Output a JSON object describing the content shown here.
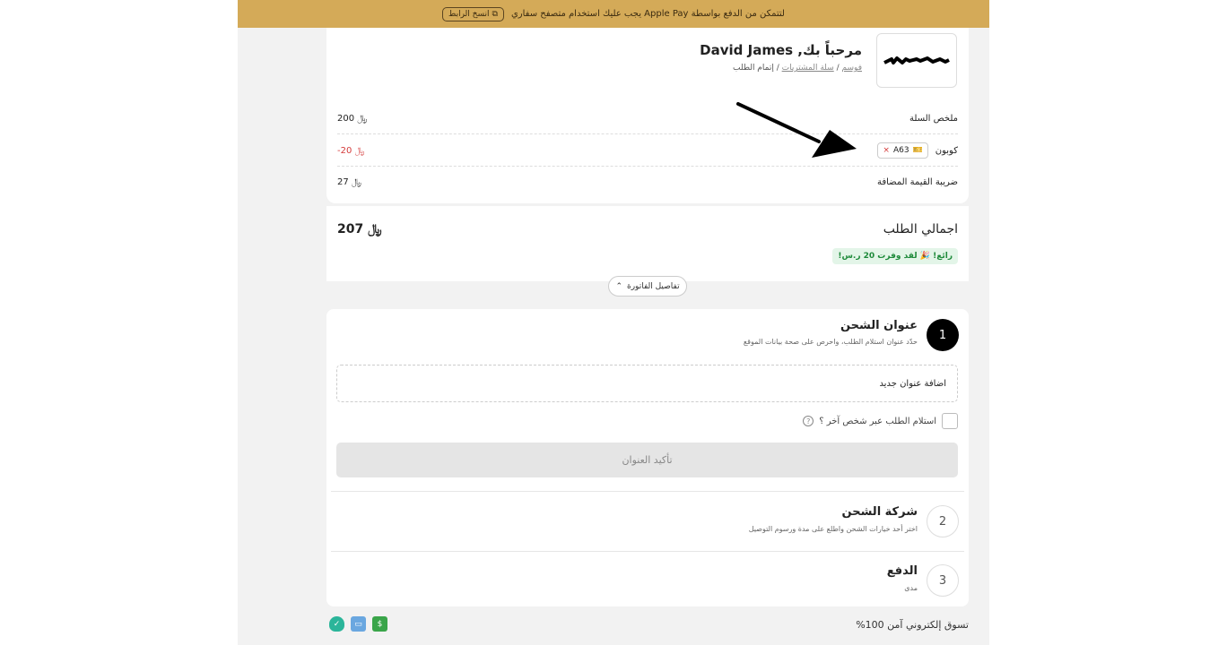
{
  "banner": {
    "message": "لتتمكن من الدفع بواسطة Apple Pay يجب عليك استخدام متصفح سفاري",
    "copy_label": "انسخ الرابط",
    "color": "#d4aa58"
  },
  "header": {
    "welcome": "مرحباً بك, David James",
    "breadcrumb": {
      "store": "فوسم",
      "sep1": "/",
      "cart": "سلة المشتريات",
      "sep2": "/",
      "current": "إتمام الطلب"
    }
  },
  "summary": {
    "cart_label": "ملخص السلة",
    "cart_value": "200 ﷼",
    "coupon_label": "كوبون",
    "coupon_code": "A63",
    "coupon_remove": "×",
    "coupon_value": "-20 ﷼",
    "vat_label": "ضريبة القيمة المضافة",
    "vat_value": "27 ﷼"
  },
  "total": {
    "label": "اجمالي الطلب",
    "value": "207 ﷼",
    "savings": "رائع! 🎉 لقد وفرت 20 ر.س!",
    "invoice_details": "تفاصيل الفاتورة",
    "invoice_icon": "chevron-up-icon"
  },
  "steps": [
    {
      "number": "1",
      "title": "عنوان الشحن",
      "subtitle": "حدّد عنوان استلام الطلب، واحرص على صحة بيانات الموقع"
    },
    {
      "number": "2",
      "title": "شركة الشحن",
      "subtitle": "اختر أحد خيارات الشحن واطلع على مدة ورسوم التوصيل"
    },
    {
      "number": "3",
      "title": "الدفع",
      "subtitle": "مدى"
    }
  ],
  "shipping": {
    "add_address": "اضافة عنوان جديد",
    "other_person": "استلام الطلب عبر شخص آخر ؟",
    "help_icon": "?",
    "confirm": "تأكيد العنوان"
  },
  "footer": {
    "secure": "تسوق إلكتروني آمن 100%",
    "icons": [
      "shield-check-icon",
      "bank-transfer-icon",
      "cash-icon"
    ]
  }
}
